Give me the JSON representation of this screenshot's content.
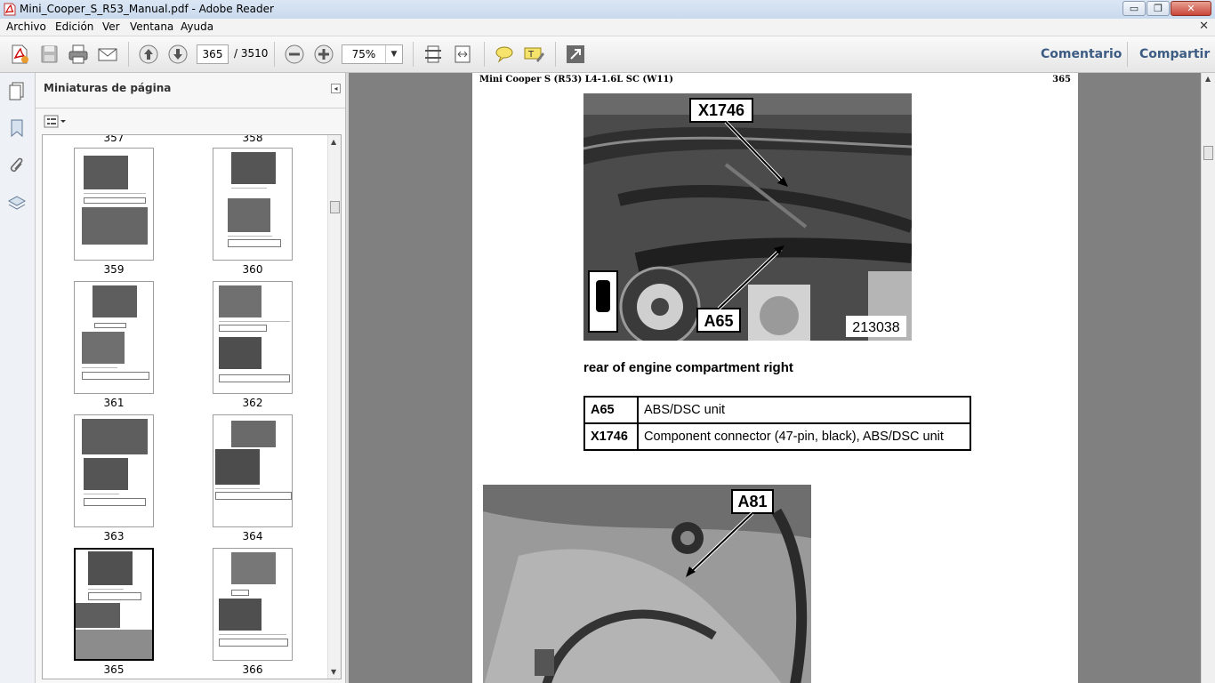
{
  "window": {
    "title": "Mini_Cooper_S_R53_Manual.pdf - Adobe Reader",
    "min_glyph": "▭",
    "max_glyph": "❐",
    "close_glyph": "✕"
  },
  "menu": {
    "items": [
      "Archivo",
      "Edición",
      "Ver",
      "Ventana",
      "Ayuda"
    ],
    "close_glyph": "✕"
  },
  "toolbar": {
    "page_current": "365",
    "page_total": "/ 3510",
    "zoom": "75%",
    "zoom_arrow": "▼",
    "comment_label": "Comentario",
    "share_label": "Compartir"
  },
  "sidebar": {
    "panel_title": "Miniaturas de página",
    "collapse_glyph": "◂",
    "thumbnails": [
      {
        "label": "357"
      },
      {
        "label": "358"
      },
      {
        "label": "359"
      },
      {
        "label": "360"
      },
      {
        "label": "361"
      },
      {
        "label": "362"
      },
      {
        "label": "363"
      },
      {
        "label": "364"
      },
      {
        "label": "365"
      },
      {
        "label": "366"
      }
    ],
    "selected_page": "365"
  },
  "document": {
    "header": "Mini Cooper S (R53) L4-1.6L SC (W11)",
    "page_number": "365",
    "figure1_labels": {
      "top": "X1746",
      "bottom": "A65",
      "id": "213038"
    },
    "caption": "rear of engine compartment right",
    "table": [
      {
        "code": "A65",
        "description": "ABS/DSC unit"
      },
      {
        "code": "X1746",
        "description": "Component connector (47-pin, black), ABS/DSC unit"
      }
    ],
    "figure2_label": "A81"
  }
}
